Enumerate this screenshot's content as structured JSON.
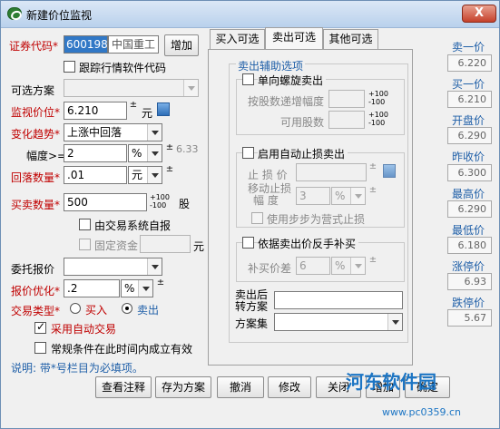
{
  "window": {
    "title": "新建价位监视",
    "close_label": "X"
  },
  "left": {
    "code_label": "证券代码",
    "code_value": "600198",
    "stock_name": "中国重工",
    "add_button": "增加",
    "follow_label": "跟踪行情软件代码",
    "scheme_label": "可选方案",
    "price_label": "监视价位",
    "price_value": "6.210",
    "price_unit": "元",
    "trend_label": "变化趋势",
    "trend_value": "上涨中回落",
    "range_label": "幅度>=",
    "range_value": "2",
    "range_unit": "%",
    "range_hint": "6.33",
    "fall_label": "回落数量",
    "fall_value": ".01",
    "fall_unit": "元",
    "qty_label": "买卖数量",
    "qty_value": "500",
    "qty_unit": "股",
    "qty_hint_top": "+100",
    "qty_hint_bottom": "-100",
    "auto_determine": "由交易系统自报",
    "fixed_fund_label": "固定资金",
    "fixed_fund_unit": "元",
    "order_label": "委托报价",
    "opt_label": "报价优化",
    "opt_value": ".2",
    "opt_unit": "%",
    "type_label": "交易类型",
    "type_buy": "买入",
    "type_sell": "卖出",
    "auto_trade": "采用自动交易",
    "cond_label": "常规条件在此时间内成立有效",
    "note": "说明: 带*号栏目为必填项。",
    "asterisk": "*"
  },
  "tabs": [
    {
      "label": "买入可选"
    },
    {
      "label": "卖出可选"
    },
    {
      "label": "其他可选"
    }
  ],
  "sell_assist": {
    "group_title": "卖出辅助选项",
    "spiral_label": "单向螺旋卖出",
    "step_label": "按股数递增幅度",
    "avail_label": "可用股数",
    "plus_minus_top": "+100",
    "plus_minus_bottom": "-100",
    "stop_group": "启用自动止损卖出",
    "stop_price_label": "止 损 价",
    "move_label_1": "移动止损",
    "move_label_2": "幅 度",
    "move_value": "3",
    "move_unit": "%",
    "step_stop_label": "使用步步为营式止损",
    "reverse_group": "依据卖出价反手补买",
    "rebuy_label": "补买价差",
    "rebuy_value": "6",
    "rebuy_unit": "%",
    "after_sell_label_1": "卖出后",
    "after_sell_label_2": "转方案",
    "scheme_set_label": "方案集"
  },
  "buttons": {
    "view_note": "查看注释",
    "save_scheme": "存为方案",
    "cancel": "撤消",
    "modify": "修改",
    "close": "关闭",
    "add": "增加",
    "confirm": "确定"
  },
  "quotes": [
    {
      "label": "卖一价",
      "value": "6.220"
    },
    {
      "label": "买一价",
      "value": "6.210"
    },
    {
      "label": "开盘价",
      "value": "6.290"
    },
    {
      "label": "昨收价",
      "value": "6.300"
    },
    {
      "label": "最高价",
      "value": "6.290"
    },
    {
      "label": "最低价",
      "value": "6.180"
    },
    {
      "label": "涨停价",
      "value": "6.93"
    },
    {
      "label": "跌停价",
      "value": "5.67"
    }
  ],
  "watermark": {
    "title": "河东软件园",
    "url": "www.pc0359.cn"
  }
}
